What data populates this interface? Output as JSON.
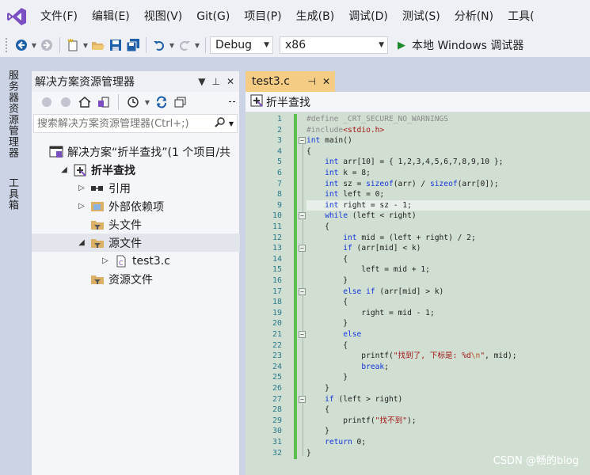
{
  "menu": [
    "文件(F)",
    "编辑(E)",
    "视图(V)",
    "Git(G)",
    "项目(P)",
    "生成(B)",
    "调试(D)",
    "测试(S)",
    "分析(N)",
    "工具("
  ],
  "toolbar": {
    "config": "Debug",
    "platform": "x86",
    "run_label": "本地 Windows 调试器"
  },
  "side_tabs": [
    "服务器资源管理器",
    "工具箱"
  ],
  "solution_explorer": {
    "title": "解决方案资源管理器",
    "search_placeholder": "搜索解决方案资源管理器(Ctrl+;)",
    "tree": [
      {
        "label": "解决方案“折半查找”(1 个项目/共",
        "level": 0,
        "expander": "",
        "icon": "solution-icon",
        "bold": false
      },
      {
        "label": "折半查找",
        "level": 1,
        "expander": "open",
        "icon": "project-icon",
        "bold": true
      },
      {
        "label": "引用",
        "level": 2,
        "expander": "closed",
        "icon": "references-icon",
        "bold": false
      },
      {
        "label": "外部依赖项",
        "level": 2,
        "expander": "closed",
        "icon": "external-deps-icon",
        "bold": false
      },
      {
        "label": "头文件",
        "level": 2,
        "expander": "",
        "icon": "filter-folder-icon",
        "bold": false
      },
      {
        "label": "源文件",
        "level": 2,
        "expander": "open",
        "icon": "filter-folder-icon",
        "bold": false,
        "selected": true
      },
      {
        "label": "test3.c",
        "level": 3,
        "expander": "closed",
        "icon": "c-file-icon",
        "bold": false
      },
      {
        "label": "资源文件",
        "level": 2,
        "expander": "",
        "icon": "filter-folder-icon",
        "bold": false
      }
    ]
  },
  "editor": {
    "tab_label": "test3.c",
    "nav_label": "折半查找",
    "current_line": 9,
    "lines": [
      [
        [
          "pp",
          "#define _CRT_SECURE_NO_WARNINGS"
        ]
      ],
      [
        [
          "pp",
          "#include"
        ],
        [
          "str",
          "<stdio.h>"
        ]
      ],
      [
        [
          "kw",
          "int"
        ],
        [
          "",
          " main()"
        ]
      ],
      [
        [
          "",
          "{"
        ]
      ],
      [
        [
          "",
          "    "
        ],
        [
          "kw",
          "int"
        ],
        [
          "",
          " arr[10] = { 1,2,3,4,5,6,7,8,9,10 };"
        ]
      ],
      [
        [
          "",
          "    "
        ],
        [
          "kw",
          "int"
        ],
        [
          "",
          " k = 8;"
        ]
      ],
      [
        [
          "",
          "    "
        ],
        [
          "kw",
          "int"
        ],
        [
          "",
          " sz = "
        ],
        [
          "kw",
          "sizeof"
        ],
        [
          "",
          "(arr) / "
        ],
        [
          "kw",
          "sizeof"
        ],
        [
          "",
          "(arr[0]);"
        ]
      ],
      [
        [
          "",
          "    "
        ],
        [
          "kw",
          "int"
        ],
        [
          "",
          " left = 0;"
        ]
      ],
      [
        [
          "",
          "    "
        ],
        [
          "kw",
          "int"
        ],
        [
          "",
          " right = sz - 1;"
        ]
      ],
      [
        [
          "",
          "    "
        ],
        [
          "kw",
          "while"
        ],
        [
          "",
          " (left < right)"
        ]
      ],
      [
        [
          "",
          "    {"
        ]
      ],
      [
        [
          "",
          "        "
        ],
        [
          "kw",
          "int"
        ],
        [
          "",
          " mid = (left + right) / 2;"
        ]
      ],
      [
        [
          "",
          "        "
        ],
        [
          "kw",
          "if"
        ],
        [
          "",
          " (arr[mid] < k)"
        ]
      ],
      [
        [
          "",
          "        {"
        ]
      ],
      [
        [
          "",
          "            left = mid + 1;"
        ]
      ],
      [
        [
          "",
          "        }"
        ]
      ],
      [
        [
          "",
          "        "
        ],
        [
          "kw",
          "else if"
        ],
        [
          "",
          " (arr[mid] > k)"
        ]
      ],
      [
        [
          "",
          "        {"
        ]
      ],
      [
        [
          "",
          "            right = mid - 1;"
        ]
      ],
      [
        [
          "",
          "        }"
        ]
      ],
      [
        [
          "",
          "        "
        ],
        [
          "kw",
          "else"
        ]
      ],
      [
        [
          "",
          "        {"
        ]
      ],
      [
        [
          "",
          "            printf("
        ],
        [
          "str",
          "\"找到了, 下标是: %d"
        ],
        [
          "esc",
          "\\n"
        ],
        [
          "str",
          "\""
        ],
        [
          "",
          ", mid);"
        ]
      ],
      [
        [
          "",
          "            "
        ],
        [
          "kw",
          "break"
        ],
        [
          "",
          ";"
        ]
      ],
      [
        [
          "",
          "        }"
        ]
      ],
      [
        [
          "",
          "    }"
        ]
      ],
      [
        [
          "",
          "    "
        ],
        [
          "kw",
          "if"
        ],
        [
          "",
          " (left > right)"
        ]
      ],
      [
        [
          "",
          "    {"
        ]
      ],
      [
        [
          "",
          "        printf("
        ],
        [
          "str",
          "\"找不到\""
        ],
        [
          "",
          ");"
        ]
      ],
      [
        [
          "",
          "    }"
        ]
      ],
      [
        [
          "",
          "    "
        ],
        [
          "kw",
          "return"
        ],
        [
          "",
          " 0;"
        ]
      ],
      [
        [
          "",
          "}"
        ]
      ]
    ],
    "fold_markers": [
      3,
      10,
      13,
      17,
      21,
      27
    ]
  },
  "watermark": "CSDN @畅的blog",
  "colors": {
    "accent_tab": "#f5cc84",
    "editor_bg": "#d1dfd3",
    "keyword": "#1437d8",
    "change_bar": "#59c04f"
  }
}
